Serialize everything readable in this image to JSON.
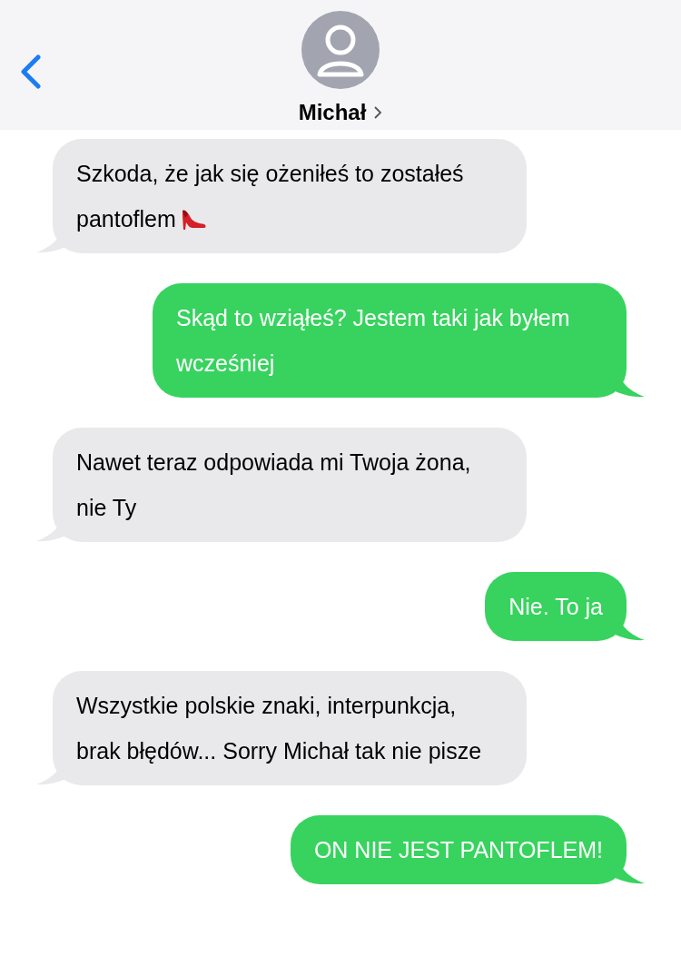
{
  "header": {
    "contact_name": "Michał"
  },
  "messages": [
    {
      "kind": "incoming",
      "text": "Szkoda, że jak się ożeniłeś to zostałeś pantoflem"
    },
    {
      "kind": "outgoing",
      "text": "Skąd to wziąłeś? Jestem taki jak byłem wcześniej"
    },
    {
      "kind": "incoming",
      "text": "Nawet teraz odpowiada mi Twoja żona, nie Ty"
    },
    {
      "kind": "outgoing",
      "text": "Nie. To ja"
    },
    {
      "kind": "incoming",
      "text": "Wszystkie polskie znaki, interpunkcja, brak błędów... Sorry Michał tak nie pisze"
    },
    {
      "kind": "outgoing",
      "text": "ON NIE JEST PANTOFLEM!"
    }
  ]
}
